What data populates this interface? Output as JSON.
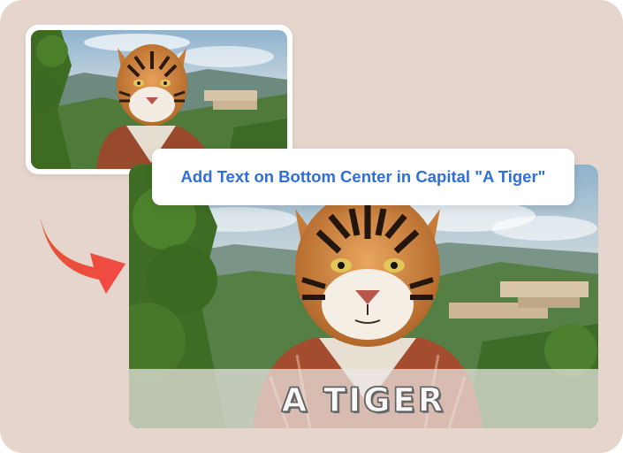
{
  "prompt": {
    "text": "Add Text on Bottom Center in Capital \"A Tiger\""
  },
  "result": {
    "caption": "A TIGER"
  },
  "images": {
    "source": "tiger-portrait-original",
    "output": "tiger-portrait-with-caption"
  },
  "colors": {
    "background": "#e6d5cd",
    "prompt_text": "#2f6fd6",
    "arrow_start": "#e2552b",
    "arrow_end": "#f24a4a"
  },
  "icons": {
    "arrow": "curved-arrow-icon"
  }
}
